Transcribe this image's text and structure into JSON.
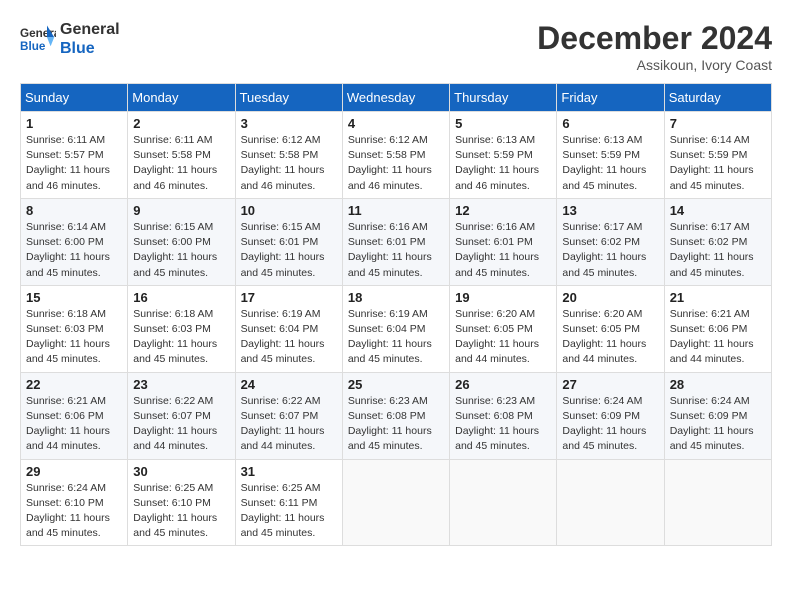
{
  "header": {
    "logo": {
      "line1": "General",
      "line2": "Blue"
    },
    "title": "December 2024",
    "subtitle": "Assikoun, Ivory Coast"
  },
  "days_of_week": [
    "Sunday",
    "Monday",
    "Tuesday",
    "Wednesday",
    "Thursday",
    "Friday",
    "Saturday"
  ],
  "weeks": [
    [
      {
        "day": "1",
        "info": "Sunrise: 6:11 AM\nSunset: 5:57 PM\nDaylight: 11 hours\nand 46 minutes."
      },
      {
        "day": "2",
        "info": "Sunrise: 6:11 AM\nSunset: 5:58 PM\nDaylight: 11 hours\nand 46 minutes."
      },
      {
        "day": "3",
        "info": "Sunrise: 6:12 AM\nSunset: 5:58 PM\nDaylight: 11 hours\nand 46 minutes."
      },
      {
        "day": "4",
        "info": "Sunrise: 6:12 AM\nSunset: 5:58 PM\nDaylight: 11 hours\nand 46 minutes."
      },
      {
        "day": "5",
        "info": "Sunrise: 6:13 AM\nSunset: 5:59 PM\nDaylight: 11 hours\nand 46 minutes."
      },
      {
        "day": "6",
        "info": "Sunrise: 6:13 AM\nSunset: 5:59 PM\nDaylight: 11 hours\nand 45 minutes."
      },
      {
        "day": "7",
        "info": "Sunrise: 6:14 AM\nSunset: 5:59 PM\nDaylight: 11 hours\nand 45 minutes."
      }
    ],
    [
      {
        "day": "8",
        "info": "Sunrise: 6:14 AM\nSunset: 6:00 PM\nDaylight: 11 hours\nand 45 minutes."
      },
      {
        "day": "9",
        "info": "Sunrise: 6:15 AM\nSunset: 6:00 PM\nDaylight: 11 hours\nand 45 minutes."
      },
      {
        "day": "10",
        "info": "Sunrise: 6:15 AM\nSunset: 6:01 PM\nDaylight: 11 hours\nand 45 minutes."
      },
      {
        "day": "11",
        "info": "Sunrise: 6:16 AM\nSunset: 6:01 PM\nDaylight: 11 hours\nand 45 minutes."
      },
      {
        "day": "12",
        "info": "Sunrise: 6:16 AM\nSunset: 6:01 PM\nDaylight: 11 hours\nand 45 minutes."
      },
      {
        "day": "13",
        "info": "Sunrise: 6:17 AM\nSunset: 6:02 PM\nDaylight: 11 hours\nand 45 minutes."
      },
      {
        "day": "14",
        "info": "Sunrise: 6:17 AM\nSunset: 6:02 PM\nDaylight: 11 hours\nand 45 minutes."
      }
    ],
    [
      {
        "day": "15",
        "info": "Sunrise: 6:18 AM\nSunset: 6:03 PM\nDaylight: 11 hours\nand 45 minutes."
      },
      {
        "day": "16",
        "info": "Sunrise: 6:18 AM\nSunset: 6:03 PM\nDaylight: 11 hours\nand 45 minutes."
      },
      {
        "day": "17",
        "info": "Sunrise: 6:19 AM\nSunset: 6:04 PM\nDaylight: 11 hours\nand 45 minutes."
      },
      {
        "day": "18",
        "info": "Sunrise: 6:19 AM\nSunset: 6:04 PM\nDaylight: 11 hours\nand 45 minutes."
      },
      {
        "day": "19",
        "info": "Sunrise: 6:20 AM\nSunset: 6:05 PM\nDaylight: 11 hours\nand 44 minutes."
      },
      {
        "day": "20",
        "info": "Sunrise: 6:20 AM\nSunset: 6:05 PM\nDaylight: 11 hours\nand 44 minutes."
      },
      {
        "day": "21",
        "info": "Sunrise: 6:21 AM\nSunset: 6:06 PM\nDaylight: 11 hours\nand 44 minutes."
      }
    ],
    [
      {
        "day": "22",
        "info": "Sunrise: 6:21 AM\nSunset: 6:06 PM\nDaylight: 11 hours\nand 44 minutes."
      },
      {
        "day": "23",
        "info": "Sunrise: 6:22 AM\nSunset: 6:07 PM\nDaylight: 11 hours\nand 44 minutes."
      },
      {
        "day": "24",
        "info": "Sunrise: 6:22 AM\nSunset: 6:07 PM\nDaylight: 11 hours\nand 44 minutes."
      },
      {
        "day": "25",
        "info": "Sunrise: 6:23 AM\nSunset: 6:08 PM\nDaylight: 11 hours\nand 45 minutes."
      },
      {
        "day": "26",
        "info": "Sunrise: 6:23 AM\nSunset: 6:08 PM\nDaylight: 11 hours\nand 45 minutes."
      },
      {
        "day": "27",
        "info": "Sunrise: 6:24 AM\nSunset: 6:09 PM\nDaylight: 11 hours\nand 45 minutes."
      },
      {
        "day": "28",
        "info": "Sunrise: 6:24 AM\nSunset: 6:09 PM\nDaylight: 11 hours\nand 45 minutes."
      }
    ],
    [
      {
        "day": "29",
        "info": "Sunrise: 6:24 AM\nSunset: 6:10 PM\nDaylight: 11 hours\nand 45 minutes."
      },
      {
        "day": "30",
        "info": "Sunrise: 6:25 AM\nSunset: 6:10 PM\nDaylight: 11 hours\nand 45 minutes."
      },
      {
        "day": "31",
        "info": "Sunrise: 6:25 AM\nSunset: 6:11 PM\nDaylight: 11 hours\nand 45 minutes."
      },
      {
        "day": "",
        "info": ""
      },
      {
        "day": "",
        "info": ""
      },
      {
        "day": "",
        "info": ""
      },
      {
        "day": "",
        "info": ""
      }
    ]
  ]
}
